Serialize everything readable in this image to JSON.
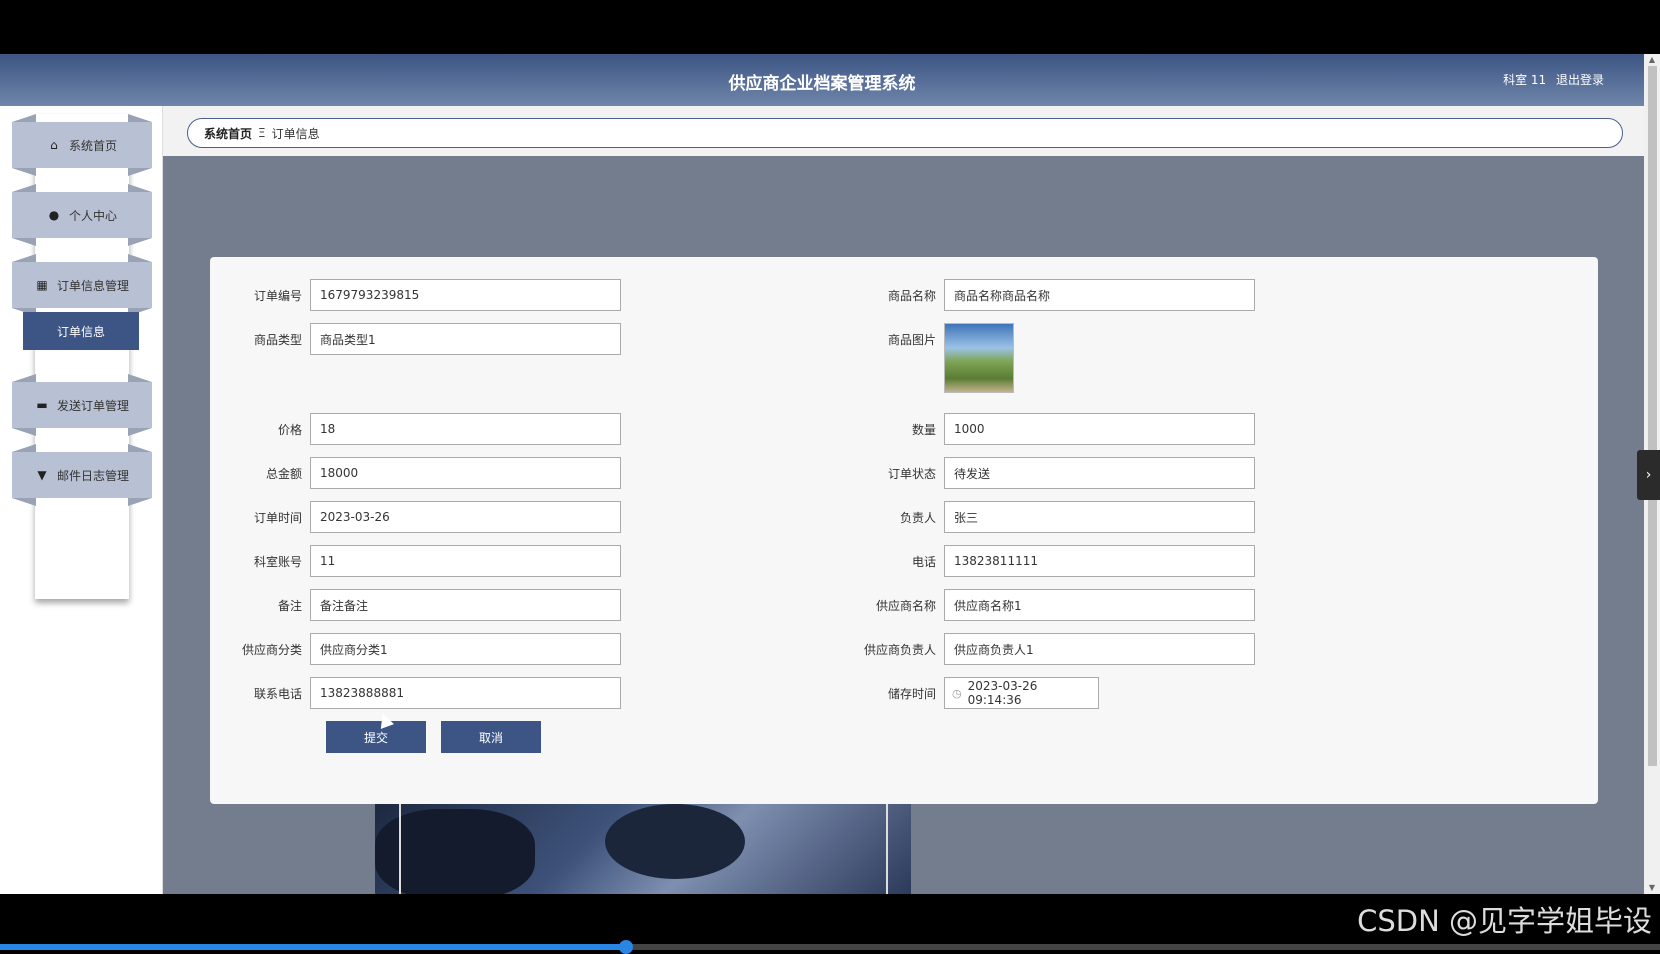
{
  "header": {
    "title": "供应商企业档案管理系统",
    "user": "科室 11",
    "logout": "退出登录"
  },
  "sidebar": {
    "items": [
      {
        "label": "系统首页",
        "icon": "home-icon"
      },
      {
        "label": "个人中心",
        "icon": "user-icon"
      },
      {
        "label": "订单信息管理",
        "icon": "grid-icon"
      },
      {
        "label": "发送订单管理",
        "icon": "send-icon"
      },
      {
        "label": "邮件日志管理",
        "icon": "mail-icon"
      }
    ],
    "submenu_active": "订单信息"
  },
  "breadcrumb": {
    "home": "系统首页",
    "separator": "Ξ",
    "current": "订单信息"
  },
  "form": {
    "order_no": {
      "label": "订单编号",
      "value": "1679793239815"
    },
    "product_name": {
      "label": "商品名称",
      "value": "商品名称商品名称"
    },
    "product_type": {
      "label": "商品类型",
      "value": "商品类型1"
    },
    "product_image": {
      "label": "商品图片"
    },
    "price": {
      "label": "价格",
      "value": "18"
    },
    "quantity": {
      "label": "数量",
      "value": "1000"
    },
    "total": {
      "label": "总金额",
      "value": "18000"
    },
    "status": {
      "label": "订单状态",
      "value": "待发送"
    },
    "order_time": {
      "label": "订单时间",
      "value": "2023-03-26"
    },
    "owner": {
      "label": "负责人",
      "value": "张三"
    },
    "dept_account": {
      "label": "科室账号",
      "value": "11"
    },
    "phone": {
      "label": "电话",
      "value": "13823811111"
    },
    "remark": {
      "label": "备注",
      "value": "备注备注"
    },
    "supplier_name": {
      "label": "供应商名称",
      "value": "供应商名称1"
    },
    "supplier_category": {
      "label": "供应商分类",
      "value": "供应商分类1"
    },
    "supplier_owner": {
      "label": "供应商负责人",
      "value": "供应商负责人1"
    },
    "contact_phone": {
      "label": "联系电话",
      "value": "13823888881"
    },
    "storage_time": {
      "label": "储存时间",
      "value": "2023-03-26 09:14:36"
    }
  },
  "buttons": {
    "submit": "提交",
    "cancel": "取消"
  },
  "watermark": "CSDN @见字学姐毕设",
  "colors": {
    "accent": "#3d5585",
    "header_top": "#3c5583",
    "main_bg": "#737d8d"
  }
}
